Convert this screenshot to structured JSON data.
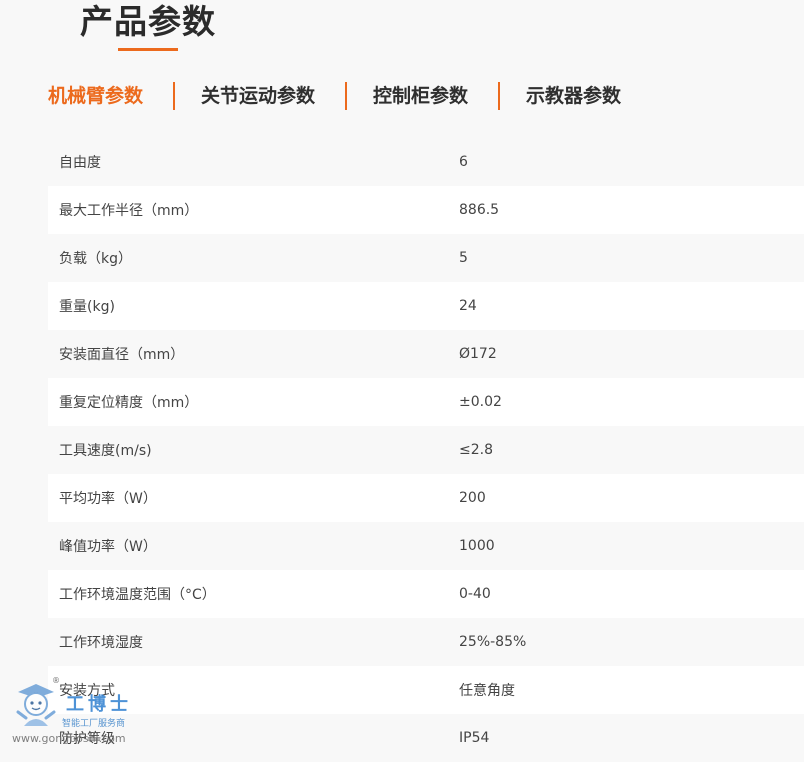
{
  "header": {
    "title": "产品参数"
  },
  "tabs": [
    {
      "label": "机械臂参数",
      "active": true
    },
    {
      "label": "关节运动参数",
      "active": false
    },
    {
      "label": "控制柜参数",
      "active": false
    },
    {
      "label": "示教器参数",
      "active": false
    }
  ],
  "specs": [
    {
      "label": "自由度",
      "value": "6"
    },
    {
      "label": "最大工作半径（mm）",
      "value": "886.5"
    },
    {
      "label": "负载（kg）",
      "value": "5"
    },
    {
      "label": "重量(kg)",
      "value": "24"
    },
    {
      "label": "安装面直径（mm）",
      "value": "Ø172"
    },
    {
      "label": "重复定位精度（mm）",
      "value": "±0.02"
    },
    {
      "label": "工具速度(m/s)",
      "value": "≤2.8"
    },
    {
      "label": "平均功率（W）",
      "value": "200"
    },
    {
      "label": "峰值功率（W）",
      "value": "1000"
    },
    {
      "label": "工作环境温度范围（°C）",
      "value": "0-40"
    },
    {
      "label": "工作环境湿度",
      "value": "25%-85%"
    },
    {
      "label": "安装方式",
      "value": "任意角度"
    },
    {
      "label": "防护等级",
      "value": "IP54"
    }
  ],
  "watermark": {
    "title": "工博士",
    "subtitle": "智能工厂服务商",
    "url": "www.gongboshi.com",
    "reg": "®"
  },
  "colors": {
    "accent": "#ec6a1d",
    "text": "#333333",
    "row_alt": "#ffffff",
    "background": "#f8f8f8"
  }
}
